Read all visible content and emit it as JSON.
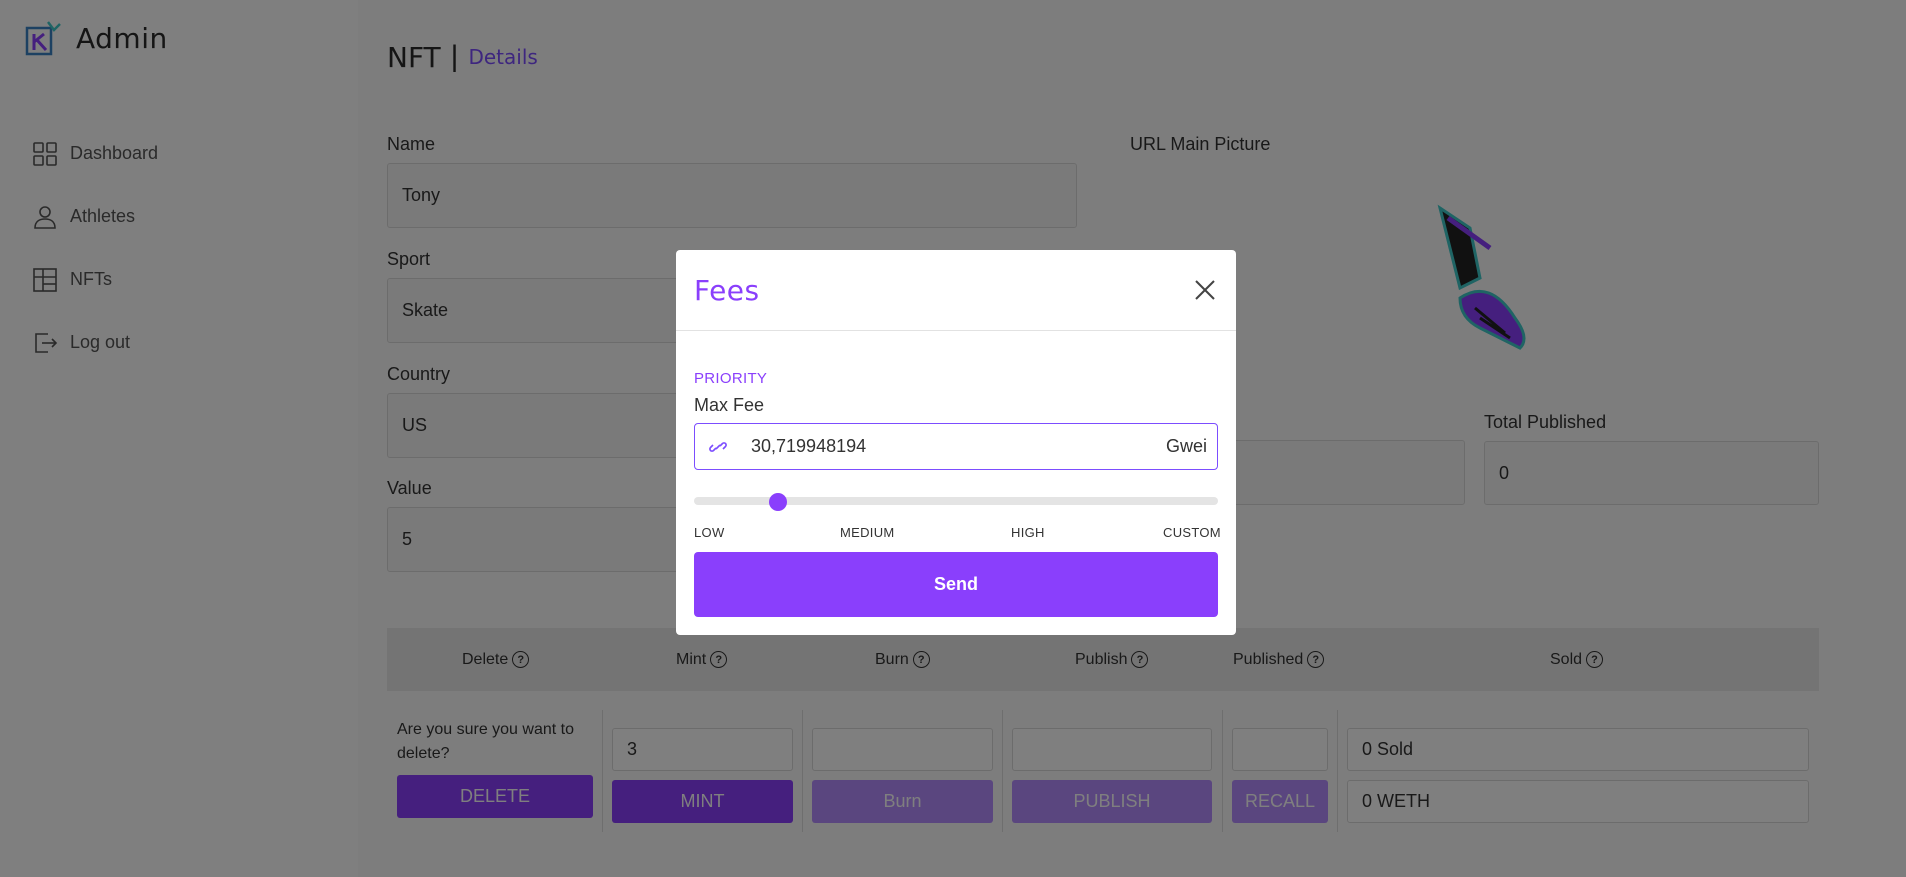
{
  "sidebar": {
    "brand": "Admin",
    "items": [
      {
        "label": "Dashboard",
        "icon": "dashboard-icon"
      },
      {
        "label": "Athletes",
        "icon": "user-icon"
      },
      {
        "label": "NFTs",
        "icon": "grid-icon"
      },
      {
        "label": "Log out",
        "icon": "logout-icon"
      }
    ]
  },
  "header": {
    "title": "NFT",
    "separator": "|",
    "subtitle": "Details"
  },
  "form": {
    "name_label": "Name",
    "name_value": "Tony",
    "sport_label": "Sport",
    "sport_value": "Skate",
    "country_label": "Country",
    "country_value": "US",
    "value_label": "Value",
    "value_value": "5",
    "picture_label": "URL Main Picture",
    "total_published_label": "Total Published",
    "total_published_value": "0"
  },
  "table": {
    "headers": [
      "Delete",
      "Mint",
      "Burn",
      "Publish",
      "Published",
      "Sold"
    ],
    "help_glyph": "?",
    "confirm_text": "Are you sure you want to delete?",
    "delete_button": "DELETE",
    "mint_value": "3",
    "mint_button": "MINT",
    "burn_button": "Burn",
    "publish_button": "PUBLISH",
    "recall_button": "RECALL",
    "sold_count": "0 Sold",
    "sold_weth": "0 WETH"
  },
  "modal": {
    "title": "Fees",
    "priority_label": "PRIORITY",
    "max_fee_label": "Max Fee",
    "max_fee_value": "30,719948194",
    "unit": "Gwei",
    "slider_fraction": 0.16,
    "ticks": [
      "LOW",
      "MEDIUM",
      "HIGH",
      "CUSTOM"
    ],
    "send_button": "Send"
  },
  "colors": {
    "accent": "#8a3ffc",
    "accent_light": "#b48cff",
    "overlay": "rgba(0,0,0,0.5)"
  }
}
